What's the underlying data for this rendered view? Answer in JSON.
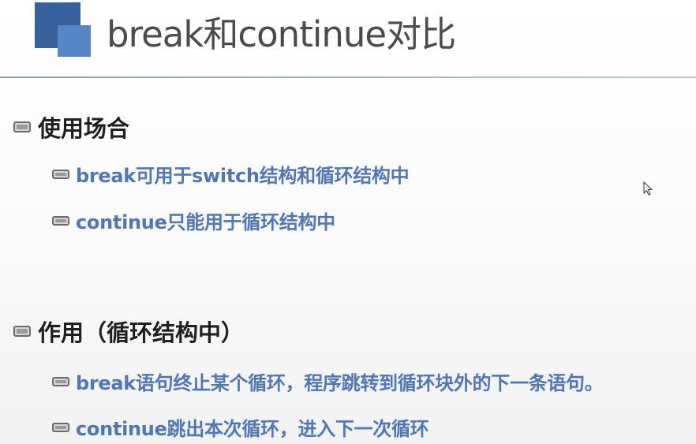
{
  "slide": {
    "title": "break和continue对比",
    "sections": [
      {
        "heading": "使用场合",
        "items": [
          "break可用于switch结构和循环结构中",
          "continue只能用于循环结构中"
        ]
      },
      {
        "heading": "作用（循环结构中）",
        "items": [
          "break语句终止某个循环，程序跳转到循环块外的下一条语句。",
          "continue跳出本次循环，进入下一次循环"
        ]
      }
    ]
  },
  "colors": {
    "logo_dark": "#36619c",
    "logo_light": "#5686c8",
    "title_text": "#4b4b4b",
    "heading_text": "#1f1f1f",
    "item_text": "#4f76b8"
  },
  "icons": {
    "bullet": "battery-bullet-icon",
    "cursor": "mouse-pointer-icon"
  }
}
